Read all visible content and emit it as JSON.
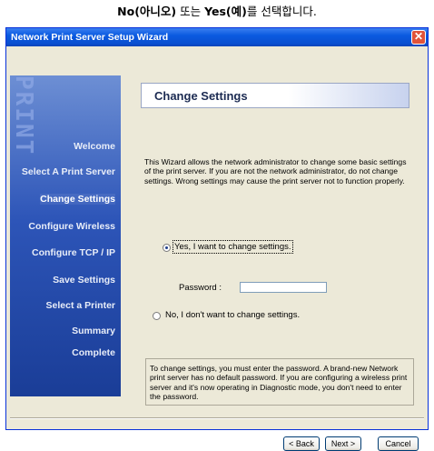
{
  "caption": {
    "part1": "No(아니오)",
    "part2": " 또는 ",
    "part3": "Yes(예)",
    "part4": "를 선택합니다."
  },
  "window": {
    "title": "Network Print Server Setup Wizard",
    "close_glyph": "✕"
  },
  "sidebar": {
    "logo_text": "PRINT",
    "items": [
      {
        "label": "Welcome"
      },
      {
        "label": "Select A Print Server"
      },
      {
        "label": "Change Settings"
      },
      {
        "label": "Configure Wireless"
      },
      {
        "label": "Configure TCP / IP"
      },
      {
        "label": "Save Settings"
      },
      {
        "label": "Select a Printer"
      },
      {
        "label": "Summary"
      },
      {
        "label": "Complete"
      }
    ]
  },
  "main": {
    "heading": "Change Settings",
    "description": "This Wizard allows the network administrator to change some basic settings of the print server. If you are not the network administrator, do not change settings. Wrong settings may cause the print server not to function properly.",
    "option_yes": "Yes, I want to change settings.",
    "password_label": "Password :",
    "password_value": "",
    "option_no": "No, I don't want to change settings.",
    "note": "To change settings, you must enter the password. A brand-new Network print server has no default password. If you are configuring a wireless print server and it's now operating in Diagnostic mode, you don't need to enter the password."
  },
  "buttons": {
    "back": "< Back",
    "next": "Next >",
    "cancel": "Cancel"
  }
}
